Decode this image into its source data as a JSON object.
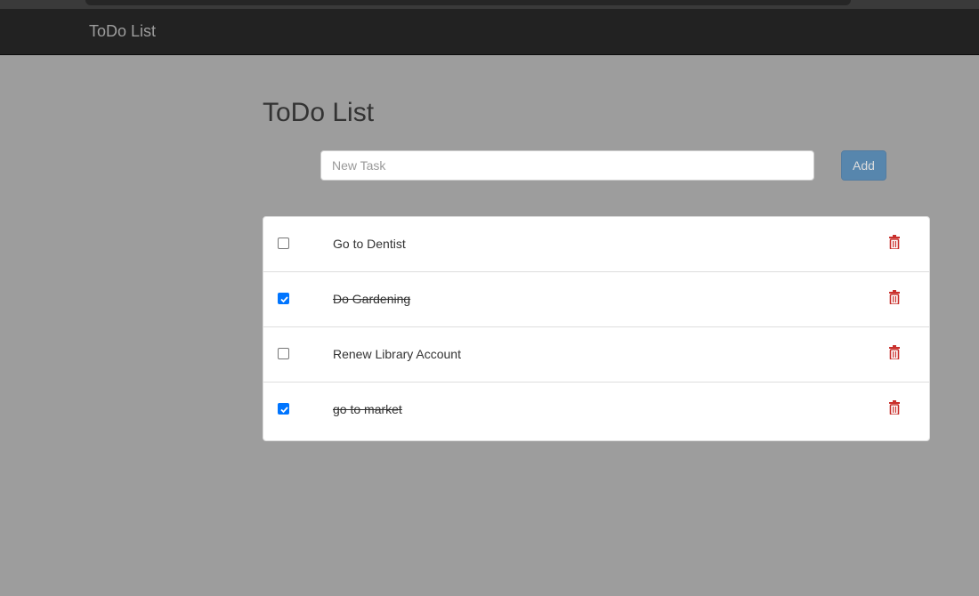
{
  "navbar": {
    "brand": "ToDo List"
  },
  "page": {
    "title": "ToDo List"
  },
  "new_task": {
    "placeholder": "New Task",
    "value": "",
    "add_label": "Add"
  },
  "tasks": [
    {
      "label": "Go to Dentist",
      "done": false
    },
    {
      "label": "Do Gardening",
      "done": true
    },
    {
      "label": "Renew Library Account",
      "done": false
    },
    {
      "label": "go to market",
      "done": true
    }
  ],
  "colors": {
    "navbar": "#222222",
    "background": "#9d9d9d",
    "accent": "#337ab7",
    "delete": "#c9302c",
    "checkbox_checked": "#0075ff"
  },
  "icons": {
    "delete": "trash-icon",
    "checkbox": "checkbox-icon"
  }
}
